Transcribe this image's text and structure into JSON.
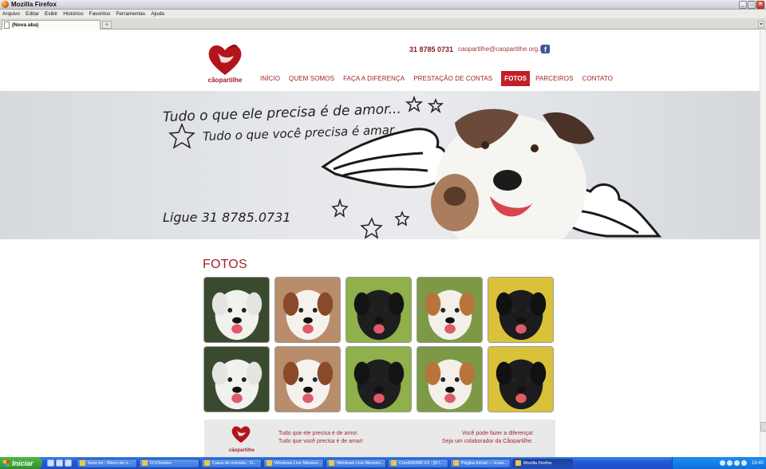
{
  "window": {
    "title": "Mozilla Firefox",
    "buttons": {
      "minimize": "_",
      "maximize": "□",
      "close": "✕"
    }
  },
  "menu": [
    "Arquivo",
    "Editar",
    "Exibir",
    "Histórico",
    "Favoritos",
    "Ferramentas",
    "Ajuda"
  ],
  "tabs": [
    {
      "label": "(Nova aba)"
    }
  ],
  "newtab_label": "+",
  "site": {
    "brand": "cãopartilhe",
    "phone": "31 8785 0731",
    "email": "caopartilhe@caopartilhe.org.br",
    "facebook_glyph": "f",
    "nav": [
      {
        "label": "INÍCIO",
        "active": false
      },
      {
        "label": "QUEM SOMOS",
        "active": false
      },
      {
        "label": "FAÇA A DIFERENÇA",
        "active": false
      },
      {
        "label": "PRESTAÇÃO DE CONTAS",
        "active": false
      },
      {
        "label": "FOTOS",
        "active": true
      },
      {
        "label": "PARCEIROS",
        "active": false
      },
      {
        "label": "CONTATO",
        "active": false
      }
    ],
    "banner": {
      "line1": "Tudo o que ele precisa é de amor...",
      "line2": "Tudo o que você precisa é amar",
      "phone": "Ligue 31 8785.0731"
    },
    "section_title": "FOTOS",
    "photos": [
      {
        "alt": "dog-white-curly",
        "bg": "#3a4a2e",
        "dog": "#f1f1ee",
        "ear": "#e4e4e0"
      },
      {
        "alt": "dog-jack-russell",
        "bg": "#b98d6b",
        "dog": "#f5f2ee",
        "ear": "#8a4a2a"
      },
      {
        "alt": "dog-black-ball",
        "bg": "#8fb04a",
        "dog": "#1e1e1e",
        "ear": "#141414"
      },
      {
        "alt": "dog-small-white-brown",
        "bg": "#7c9a45",
        "dog": "#f3efe9",
        "ear": "#b8743a"
      },
      {
        "alt": "dog-black-flowers",
        "bg": "#d9c23a",
        "dog": "#1c1c1c",
        "ear": "#111111"
      },
      {
        "alt": "dog-white-curly",
        "bg": "#3a4a2e",
        "dog": "#f1f1ee",
        "ear": "#e4e4e0"
      },
      {
        "alt": "dog-jack-russell",
        "bg": "#b98d6b",
        "dog": "#f5f2ee",
        "ear": "#8a4a2a"
      },
      {
        "alt": "dog-black-ball",
        "bg": "#8fb04a",
        "dog": "#1e1e1e",
        "ear": "#141414"
      },
      {
        "alt": "dog-small-white-brown",
        "bg": "#7c9a45",
        "dog": "#f3efe9",
        "ear": "#b8743a"
      },
      {
        "alt": "dog-black-flowers",
        "bg": "#d9c23a",
        "dog": "#1c1c1c",
        "ear": "#111111"
      }
    ],
    "footer": {
      "brand": "cãopartilhe",
      "left_line1": "Tudo que ele precisa é de amor.",
      "left_line2": "Tudo que você precisa é de amar!",
      "right_line1": "Você pode fazer a diferença!",
      "right_line2": "Seja um colaborador da Cãopartilhe."
    },
    "colors": {
      "brand_red": "#a21e26",
      "active_nav": "#c21e27"
    }
  },
  "taskbar": {
    "start_label": "Iniciar",
    "items": [
      {
        "label": "fazer.txt - Bloco de n...",
        "active": false
      },
      {
        "label": "D:\\Clientes",
        "active": false
      },
      {
        "label": "Caixa de entrada - O...",
        "active": false
      },
      {
        "label": "Windows Live Messen...",
        "active": false
      },
      {
        "label": "Windows Live Messen...",
        "active": false
      },
      {
        "label": "CorelDRAW X3 - [D:\\...",
        "active": false
      },
      {
        "label": "Página Inicial — Esse...",
        "active": false
      },
      {
        "label": "Mozilla Firefox",
        "active": true
      }
    ],
    "clock": "16:40"
  }
}
